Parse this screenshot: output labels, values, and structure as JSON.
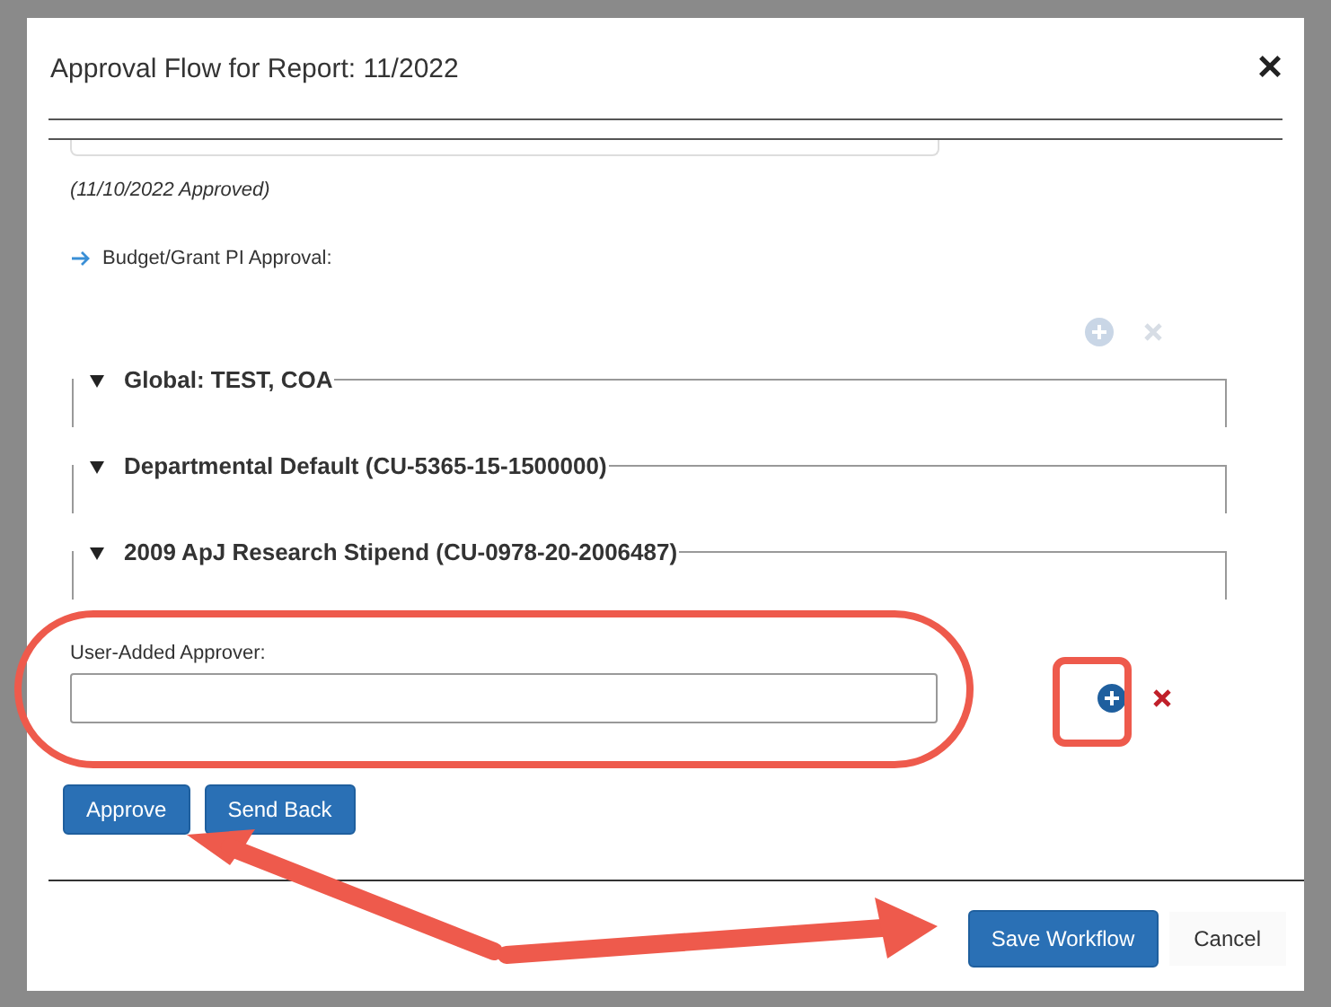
{
  "dialog": {
    "title": "Approval Flow for Report: 11/2022",
    "close": "×"
  },
  "approved_note": "(11/10/2022 Approved)",
  "step": {
    "label": "Budget/Grant PI Approval:"
  },
  "step_actions": {
    "disabled": true
  },
  "groups": [
    {
      "legend": "Global:  TEST, COA",
      "expanded": true
    },
    {
      "legend": "Departmental Default (CU-5365-15-1500000)",
      "expanded": true
    },
    {
      "legend": "2009 ApJ Research Stipend (CU-0978-20-2006487)",
      "expanded": true
    }
  ],
  "user_added": {
    "label": "User-Added Approver:"
  },
  "buttons": [
    {
      "label": "Approve"
    },
    {
      "label": "Send Back"
    }
  ],
  "footer": [
    {
      "label": "Save Workflow",
      "kind": "primary"
    },
    {
      "label": "Cancel",
      "kind": "plain"
    }
  ]
}
